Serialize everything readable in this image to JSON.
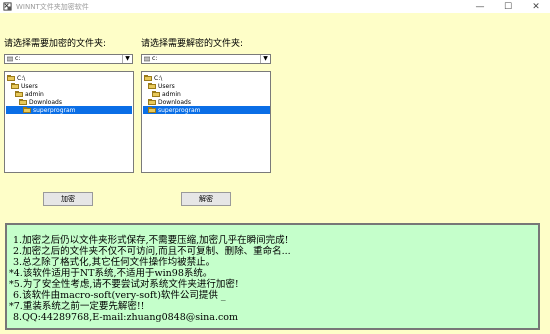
{
  "window": {
    "title": "WINNT文件夹加密软件",
    "minimize_glyph": "—",
    "maximize_glyph": "☐",
    "close_glyph": "✕"
  },
  "left_panel": {
    "label": "请选择需要加密的文件夹:",
    "drive_value": "c:",
    "tree": [
      {
        "label": "C:\\",
        "selected": false
      },
      {
        "label": "Users",
        "selected": false
      },
      {
        "label": "admin",
        "selected": false
      },
      {
        "label": "Downloads",
        "selected": false
      },
      {
        "label": "superprogram",
        "selected": true
      }
    ],
    "button_label": "加密"
  },
  "right_panel": {
    "label": "请选择需要解密的文件夹:",
    "drive_value": "c:",
    "tree": [
      {
        "label": "C:\\",
        "selected": false
      },
      {
        "label": "Users",
        "selected": false
      },
      {
        "label": "admin",
        "selected": false
      },
      {
        "label": "Downloads",
        "selected": false
      },
      {
        "label": "superprogram",
        "selected": true
      }
    ],
    "button_label": "解密"
  },
  "info_lines": [
    " 1.加密之后仍以文件夹形式保存,不需要压缩,加密几乎在瞬间完成!",
    " 2.加密之后的文件夹不仅不可访问,而且不可复制、删除、重命名...",
    " 3.总之除了格式化,其它任何文件操作均被禁止。",
    "*4.该软件适用于NT系统,不适用于win98系统。",
    "*5.为了安全性考虑,请不要尝试对系统文件夹进行加密!",
    " 6.该软件由macro-soft(very-soft)软件公司提供 _",
    "*7.重装系统之前一定要先解密!!",
    " 8.QQ:44289768,E-mail:zhuang0848@sina.com"
  ]
}
